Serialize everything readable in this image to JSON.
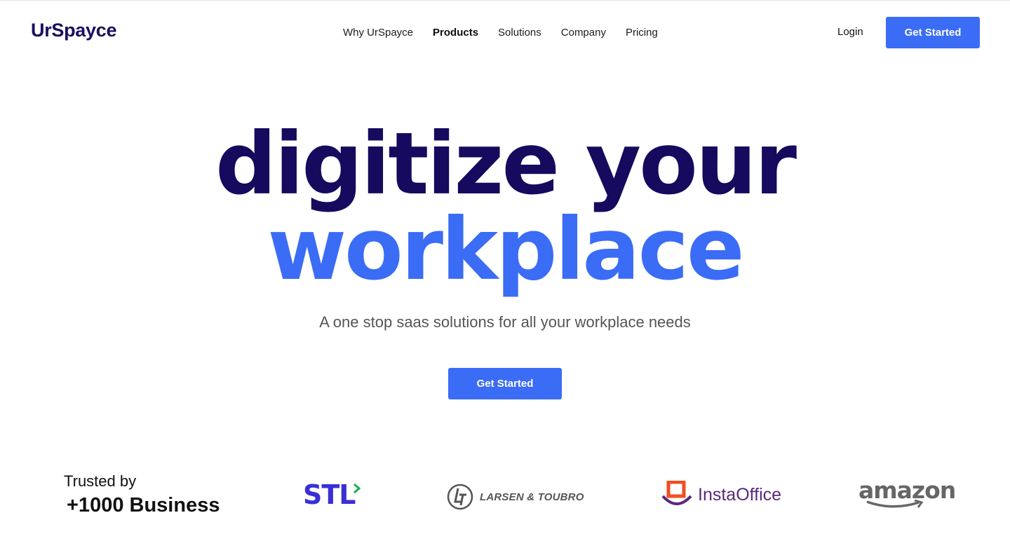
{
  "nav": {
    "logo": "UrSpayce",
    "items": [
      {
        "label": "Why UrSpayce"
      },
      {
        "label": "Products"
      },
      {
        "label": "Solutions"
      },
      {
        "label": "Company"
      },
      {
        "label": "Pricing"
      }
    ],
    "login": "Login",
    "cta": "Get Started"
  },
  "hero": {
    "line1": "digitize your",
    "line2": "workplace",
    "subtitle": "A one stop saas solutions for all your workplace needs",
    "cta": "Get Started"
  },
  "trusted": {
    "line1": "Trusted by",
    "line2": "+1000 Business"
  },
  "partners": [
    {
      "name": "STL"
    },
    {
      "name": "LARSEN & TOUBRO"
    },
    {
      "name": "InstaOffice"
    },
    {
      "name": "amazon"
    }
  ],
  "colors": {
    "brand_dark": "#150a5e",
    "accent": "#3b6cf6",
    "subtitle": "#555555"
  }
}
